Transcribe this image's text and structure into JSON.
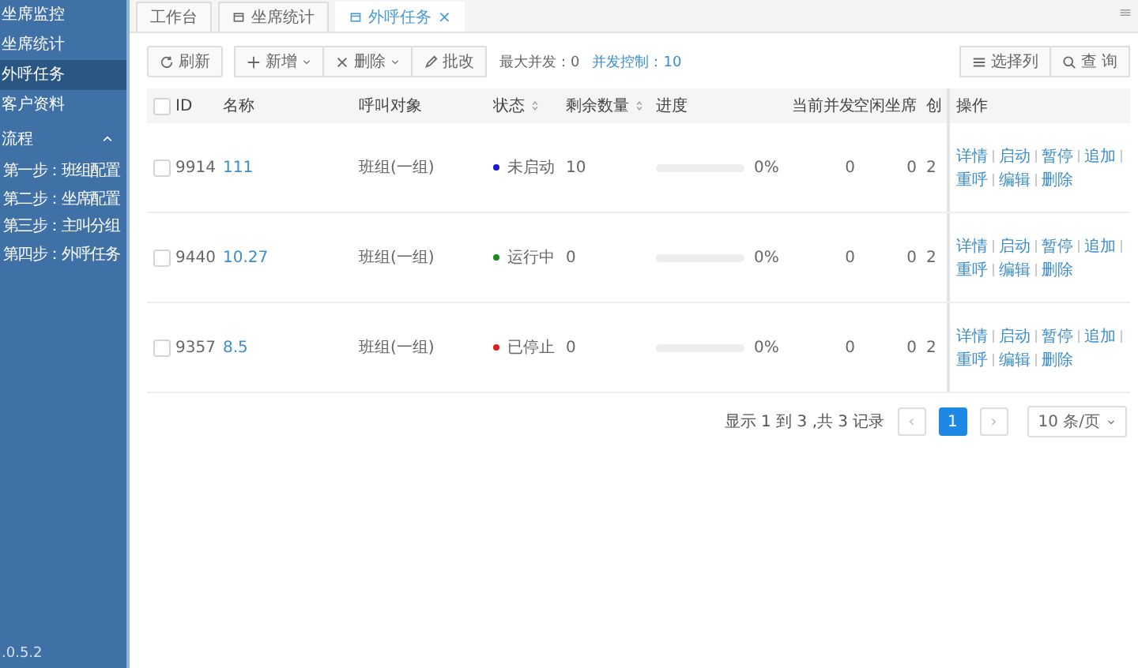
{
  "sidebar": {
    "items": [
      {
        "label": "坐席监控",
        "kind": "link",
        "selected": false
      },
      {
        "label": "坐席统计",
        "kind": "link",
        "selected": false
      },
      {
        "label": "外呼任务",
        "kind": "link",
        "selected": true
      },
      {
        "label": "客户资料",
        "kind": "link",
        "selected": false
      },
      {
        "label": "流程",
        "kind": "group",
        "expanded": true,
        "children": [
          {
            "label": "第一步：班组配置",
            "selected": false
          },
          {
            "label": "第二步：坐席配置",
            "selected": false
          },
          {
            "label": "第三步：主叫分组",
            "selected": false
          },
          {
            "label": "第四步：外呼任务",
            "selected": false
          }
        ]
      }
    ],
    "version": ".0.5.2"
  },
  "tabs": [
    {
      "label": "工作台",
      "selected": false,
      "icon": false
    },
    {
      "label": "坐席统计",
      "selected": false,
      "icon": true
    },
    {
      "label": "外呼任务",
      "selected": true,
      "icon": true,
      "close": "×"
    }
  ],
  "toolbar": {
    "buttons": [
      {
        "label": "刷新",
        "kind": "refresh",
        "dropdown": false
      }
    ],
    "button_group": [
      {
        "label": "新增",
        "kind": "add",
        "dropdown": true
      },
      {
        "label": "删除",
        "kind": "delete",
        "dropdown": true
      },
      {
        "label": "批改",
        "kind": "edit",
        "dropdown": false
      }
    ],
    "stats": [
      {
        "text": "最大并发：0",
        "link": false
      },
      {
        "text": "并发控制：10",
        "link": true
      }
    ],
    "right_buttons": [
      {
        "label": "选择列",
        "kind": "columns"
      },
      {
        "label": "查 询",
        "kind": "search"
      }
    ]
  },
  "table": {
    "all_checked": false,
    "columns": [
      {
        "label": "ID",
        "sortable": false
      },
      {
        "label": "名称",
        "sortable": false
      },
      {
        "label": "呼叫对象",
        "sortable": false
      },
      {
        "label": "状态",
        "sortable": true
      },
      {
        "label": "剩余数量",
        "sortable": true
      },
      {
        "label": "进度",
        "sortable": false
      },
      {
        "label": "当前并发",
        "sortable": false
      },
      {
        "label": "空闲坐席",
        "sortable": false
      },
      {
        "label": "创",
        "sortable": false
      },
      {
        "label": "操作",
        "sortable": false
      }
    ],
    "rows": [
      {
        "checked": false,
        "id": "9914",
        "name": "111",
        "target": "班组(一组)",
        "status": "未启动",
        "color": "#1a1ac8",
        "remaining": "10",
        "level": 0,
        "progress": "0%",
        "concurrent": "0",
        "idle": "0",
        "column_9": "2",
        "actions": [
          "详情",
          "启动",
          "暂停",
          "追加",
          "重呼",
          "编辑",
          "删除"
        ]
      },
      {
        "checked": false,
        "id": "9440",
        "name": "10.27",
        "target": "班组(一组)",
        "status": "运行中",
        "color": "#1a8a1a",
        "remaining": "0",
        "level": 0,
        "progress": "0%",
        "concurrent": "0",
        "idle": "0",
        "column_9": "2",
        "actions": [
          "详情",
          "启动",
          "暂停",
          "追加",
          "重呼",
          "编辑",
          "删除"
        ]
      },
      {
        "checked": false,
        "id": "9357",
        "name": "8.5",
        "target": "班组(一组)",
        "status": "已停止",
        "color": "#e02020",
        "remaining": "0",
        "level": 0,
        "progress": "0%",
        "concurrent": "0",
        "idle": "0",
        "column_9": "2",
        "actions": [
          "详情",
          "启动",
          "暂停",
          "追加",
          "重呼",
          "编辑",
          "删除"
        ]
      }
    ]
  },
  "pagination": {
    "summary": "显示 1 到 3 ,共 3 记录",
    "prev": "‹",
    "pages": [
      {
        "label": "1",
        "selected": true
      }
    ],
    "next": "›",
    "page_size": "10 条/页"
  }
}
